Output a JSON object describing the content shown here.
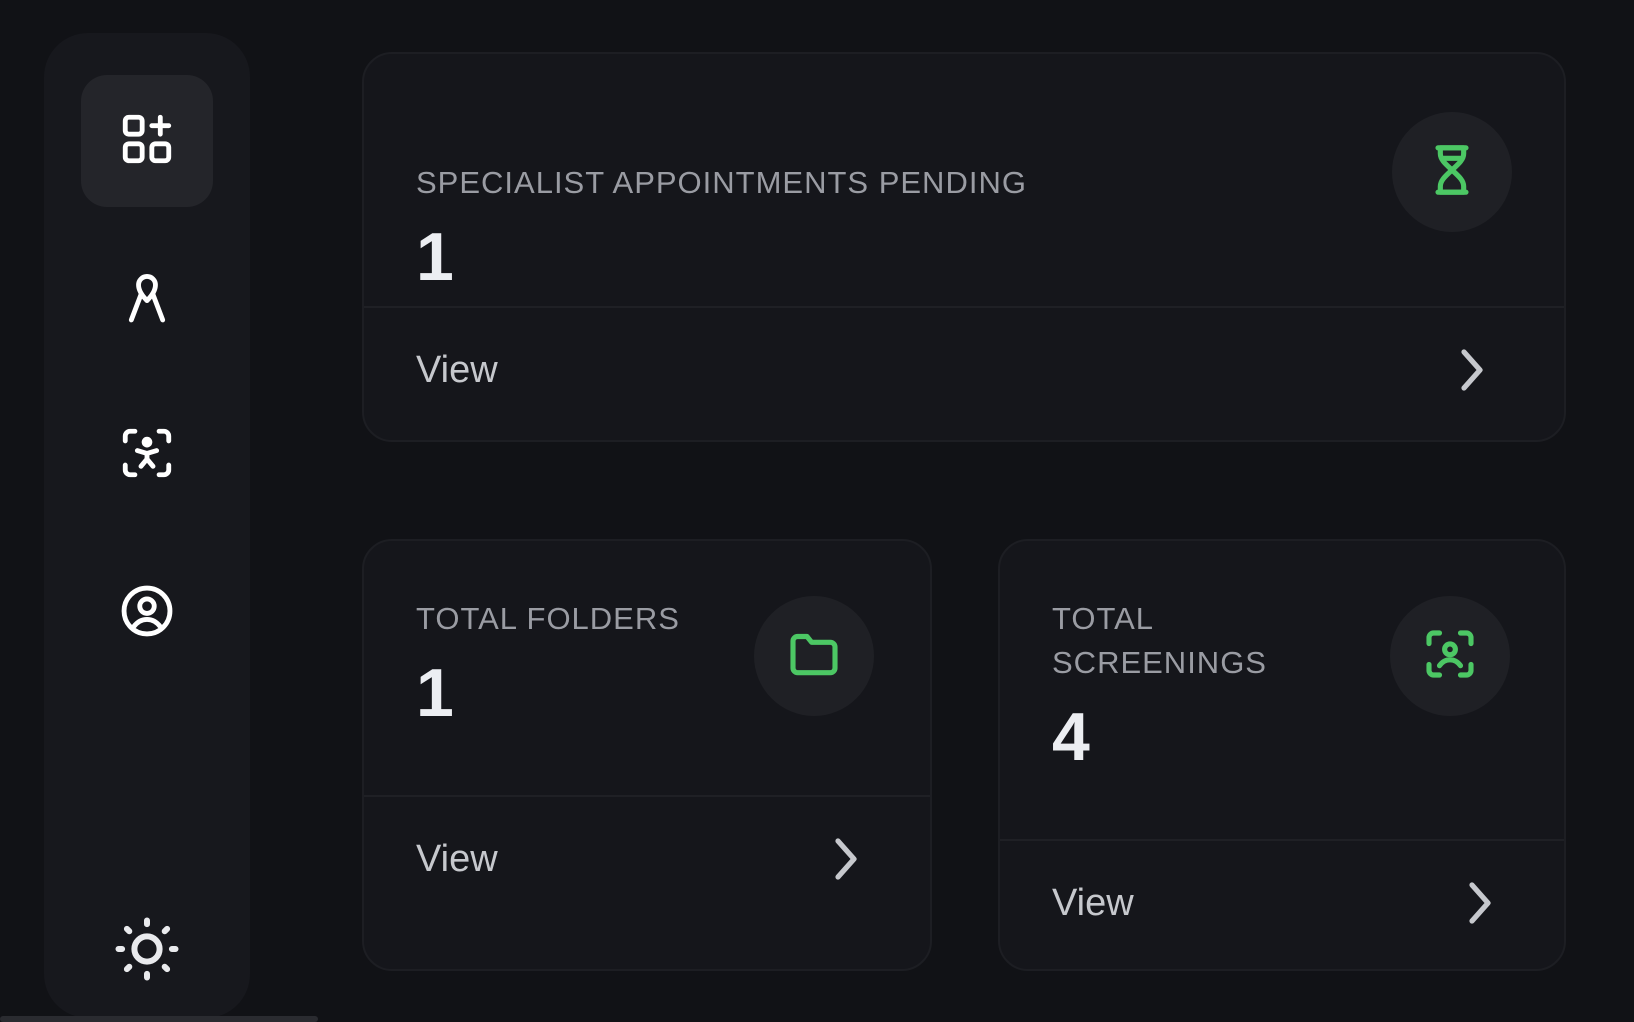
{
  "sidebar": {
    "items": [
      {
        "name": "dashboard",
        "icon": "grid-plus-icon",
        "active": true
      },
      {
        "name": "awareness",
        "icon": "ribbon-icon",
        "active": false
      },
      {
        "name": "screening",
        "icon": "scan-person-icon",
        "active": false
      },
      {
        "name": "profile",
        "icon": "user-circle-icon",
        "active": false
      }
    ],
    "theme_toggle_icon": "sun-icon"
  },
  "cards": {
    "appointments": {
      "title": "SPECIALIST APPOINTMENTS PENDING",
      "value": "1",
      "icon": "hourglass-icon",
      "action_label": "View"
    },
    "folders": {
      "title": "TOTAL FOLDERS",
      "value": "1",
      "icon": "folder-icon",
      "action_label": "View"
    },
    "screenings": {
      "title_line1": "TOTAL",
      "title_line2": "SCREENINGS",
      "value": "4",
      "icon": "face-scan-icon",
      "action_label": "View"
    }
  },
  "colors": {
    "background": "#111216",
    "card": "#15161b",
    "accent": "#4cc764",
    "text_muted": "#9a9ca3"
  }
}
